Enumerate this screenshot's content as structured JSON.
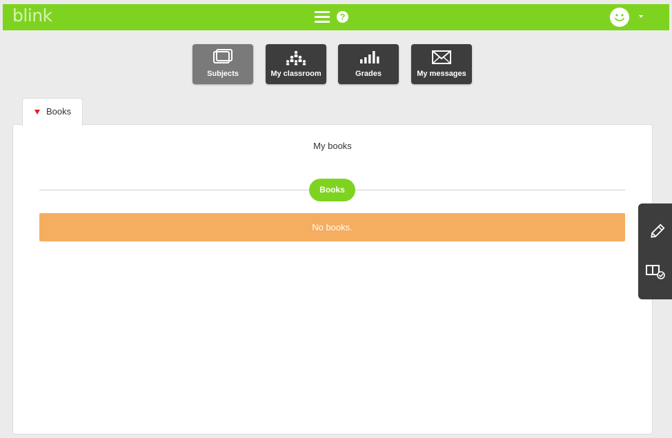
{
  "app": {
    "logo": "blink",
    "brand_color": "#7ed321"
  },
  "header": {
    "menu_icon": "hamburger-icon",
    "help_icon": "help-icon",
    "help_glyph": "?",
    "avatar_icon": "smiley-avatar-icon"
  },
  "nav": {
    "items": [
      {
        "label": "Subjects",
        "icon": "subjects-icon",
        "active": true
      },
      {
        "label": "My classroom",
        "icon": "classroom-icon",
        "active": false
      },
      {
        "label": "Grades",
        "icon": "grades-icon",
        "active": false
      },
      {
        "label": "My messages",
        "icon": "messages-icon",
        "active": false
      }
    ]
  },
  "tab": {
    "label": "Books"
  },
  "panel": {
    "title": "My books",
    "section_label": "Books",
    "empty_message": "No books."
  },
  "side_toolbar": {
    "items": [
      {
        "icon": "pencil-icon"
      },
      {
        "icon": "book-check-icon"
      }
    ]
  }
}
